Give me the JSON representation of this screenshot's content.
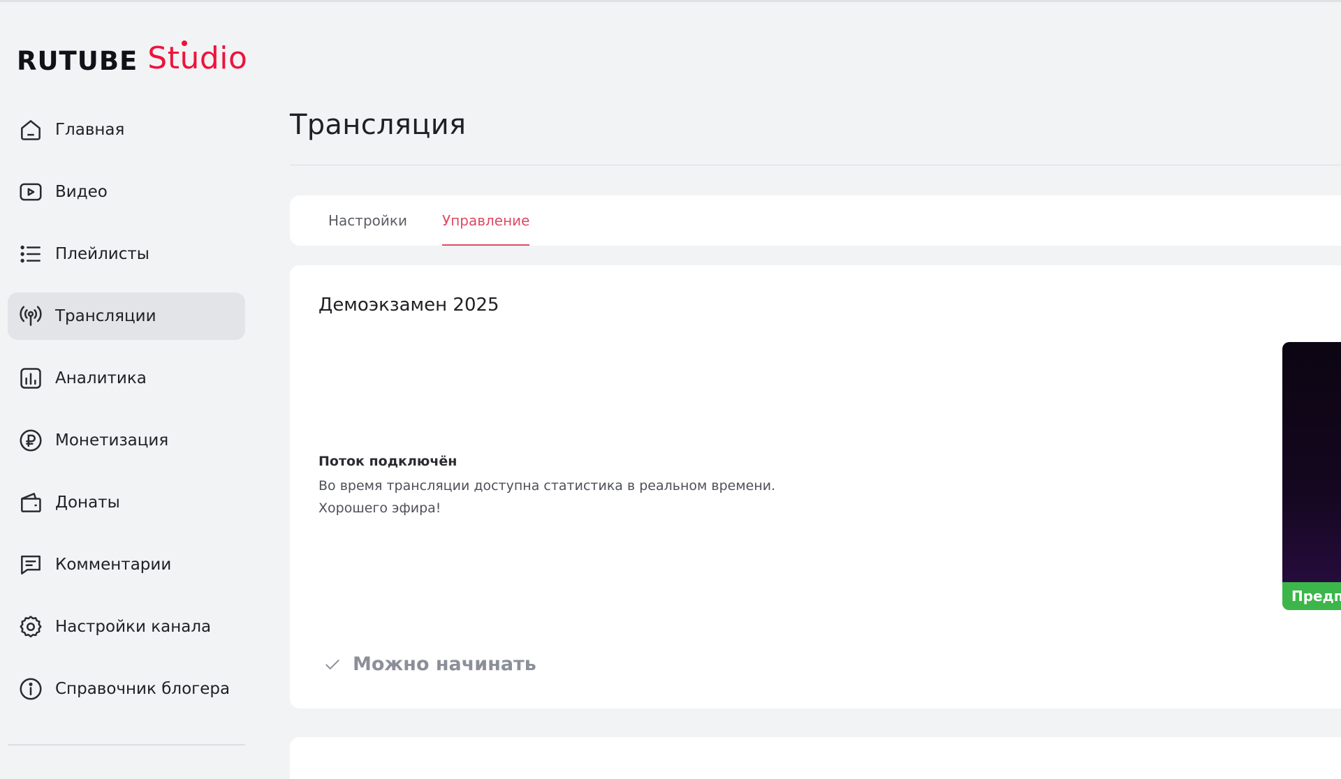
{
  "logo": {
    "brand": "RUTUBE",
    "product": "Studio"
  },
  "colors": {
    "accent": "#ed143b",
    "active_tab": "#e04a62",
    "badge_green": "#3cb54a",
    "background": "#f2f3f5"
  },
  "sidebar": {
    "items": [
      {
        "label": "Главная",
        "icon": "home-icon"
      },
      {
        "label": "Видео",
        "icon": "video-icon"
      },
      {
        "label": "Плейлисты",
        "icon": "playlist-icon"
      },
      {
        "label": "Трансляции",
        "icon": "broadcast-icon",
        "active": true
      },
      {
        "label": "Аналитика",
        "icon": "analytics-icon"
      },
      {
        "label": "Монетизация",
        "icon": "ruble-icon"
      },
      {
        "label": "Донаты",
        "icon": "wallet-icon"
      },
      {
        "label": "Комментарии",
        "icon": "comment-icon"
      },
      {
        "label": "Настройки канала",
        "icon": "gear-icon"
      },
      {
        "label": "Справочник блогера",
        "icon": "info-icon"
      }
    ]
  },
  "page": {
    "title": "Трансляция"
  },
  "tabs": [
    {
      "label": "Настройки",
      "active": false
    },
    {
      "label": "Управление",
      "active": true
    }
  ],
  "stream": {
    "name": "Демоэкзамен 2025",
    "status_title": "Поток подключён",
    "status_line1": "Во время трансляции доступна статистика в реальном времени.",
    "status_line2": "Хорошего эфира!",
    "ready_label": "Можно начинать",
    "preview_badge": "Предпр"
  }
}
